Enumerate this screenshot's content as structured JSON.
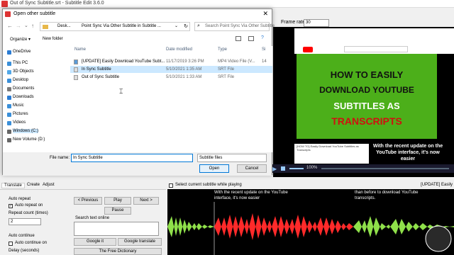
{
  "app": {
    "title": "Out of Sync Subtitle.srt - Subtitle Edit 3.6.0"
  },
  "video_panel": {
    "frame_rate_label": "Frame rate:",
    "frame_rate_value": "30",
    "thumbnail_lines": [
      "HOW TO EASILY",
      "DOWNLOAD YOUTUBE",
      "SUBTITLES AS",
      "TRANSCRIPTS"
    ],
    "video_meta": "[HOW TO] Easily Download YouTube Subtitles as Transcripts",
    "subtitle_overlay": "With the recent update on the YouTube interface, it's now easier",
    "player_pct": "100%"
  },
  "dialog": {
    "title": "Open other subtitle",
    "breadcrumb": [
      "Desk...",
      "Point Sync Via Other Subtitle in Subtitle ..."
    ],
    "search_placeholder": "Search Point Sync Via Other Subtitle",
    "organize_label": "Organize ▾",
    "new_folder_label": "New folder",
    "nav_items": [
      {
        "label": "OneDrive",
        "icon": "cloud-icon",
        "color": "#2b7cd3"
      },
      {
        "label": "This PC",
        "icon": "computer-icon",
        "color": "#3a8fd9"
      },
      {
        "label": "3D Objects",
        "icon": "cube-icon",
        "color": "#52a8e8"
      },
      {
        "label": "Desktop",
        "icon": "desktop-icon",
        "color": "#3a8fd9"
      },
      {
        "label": "Documents",
        "icon": "document-icon",
        "color": "#7a7a7a"
      },
      {
        "label": "Downloads",
        "icon": "download-icon",
        "color": "#2b7cd3"
      },
      {
        "label": "Music",
        "icon": "music-icon",
        "color": "#3a8fd9"
      },
      {
        "label": "Pictures",
        "icon": "picture-icon",
        "color": "#3a8fd9"
      },
      {
        "label": "Videos",
        "icon": "video-icon",
        "color": "#3a8fd9"
      },
      {
        "label": "Windows (C:)",
        "icon": "drive-icon",
        "color": "#666666"
      },
      {
        "label": "New Volume (D:)",
        "icon": "drive-icon",
        "color": "#666666"
      }
    ],
    "columns": [
      "Name",
      "Date modified",
      "Type",
      "Si"
    ],
    "files": [
      {
        "name": "[UPDATE] Easily Download YouTube Subt...",
        "date": "11/17/2019 3:26 PM",
        "type": "MP4 Video File (V...",
        "size": "14"
      },
      {
        "name": "In Sync Subtitle",
        "date": "5/10/2021 1:35 AM",
        "type": "SRT File",
        "size": ""
      },
      {
        "name": "Out of Sync Subtitle",
        "date": "5/10/2021 1:33 AM",
        "type": "SRT File",
        "size": ""
      }
    ],
    "filename_label": "File name:",
    "filename_value": "In Sync Subtitle",
    "filetype_value": "Subtitle files",
    "open_label": "Open",
    "cancel_label": "Cancel"
  },
  "bottom": {
    "tabs": [
      "Translate",
      "Create",
      "Adjust"
    ],
    "auto_repeat": "Auto repeat",
    "auto_repeat_on": "Auto repeat on",
    "repeat_count_label": "Repeat count (times)",
    "repeat_count_value": "2",
    "auto_continue": "Auto continue",
    "auto_continue_on": "Auto continue on",
    "delay_label": "Delay (seconds)",
    "previous_label": "< Previous",
    "play_label": "Play",
    "next_label": "Next >",
    "pause_label": "Pause",
    "search_text_label": "Search text online",
    "google_it_label": "Google it",
    "google_translate_label": "Google translate",
    "free_dictionary_label": "The Free Dictionary",
    "select_current_label": "Select current subtitle while playing",
    "waveform_right_label": "[UPDATE] Easily",
    "waveform_sub1": "With the recent update on the YouTube interface, it's now easier",
    "waveform_sub2": "than before to download YouTube transcripts."
  },
  "colors": {
    "waveform_red": "#ff2a2a",
    "waveform_green": "#8fe04a",
    "thumb_green": "#4caf1a",
    "selection_blue": "#cce8ff"
  }
}
